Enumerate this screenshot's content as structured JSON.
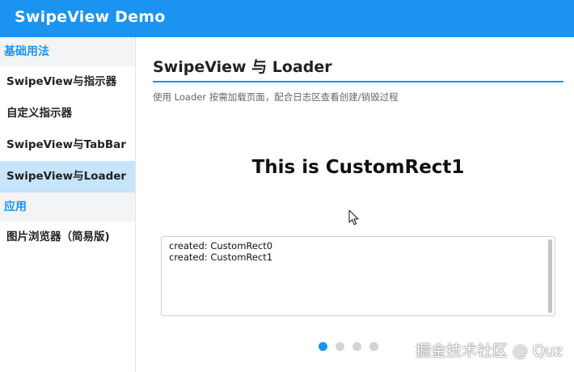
{
  "app": {
    "title": "SwipeView Demo"
  },
  "sidebar": {
    "groups": [
      {
        "header": "基础用法",
        "items": [
          {
            "label": "SwipeView与指示器",
            "active": false
          },
          {
            "label": "自定义指示器",
            "active": false
          },
          {
            "label": "SwipeView与TabBar",
            "active": false
          },
          {
            "label": "SwipeView与Loader",
            "active": true
          }
        ]
      },
      {
        "header": "应用",
        "items": [
          {
            "label": "图片浏览器（简易版)",
            "active": false
          }
        ]
      }
    ]
  },
  "main": {
    "title": "SwipeView 与 Loader",
    "description": "使用 Loader 按需加载页面，配合日志区查看创建/销毁过程",
    "slide_text": "This is CustomRect1",
    "log": {
      "lines": [
        "created: CustomRect0",
        "created: CustomRect1"
      ]
    },
    "indicator": {
      "count": 4,
      "current_index": 0
    }
  },
  "watermark": "掘金技术社区 @ Quz",
  "colors": {
    "accent": "#1a94f0",
    "active_item_bg": "#c6e4fa",
    "group_header_bg": "#f2f4f6"
  },
  "icons": {
    "cursor": "mouse-pointer-icon"
  }
}
